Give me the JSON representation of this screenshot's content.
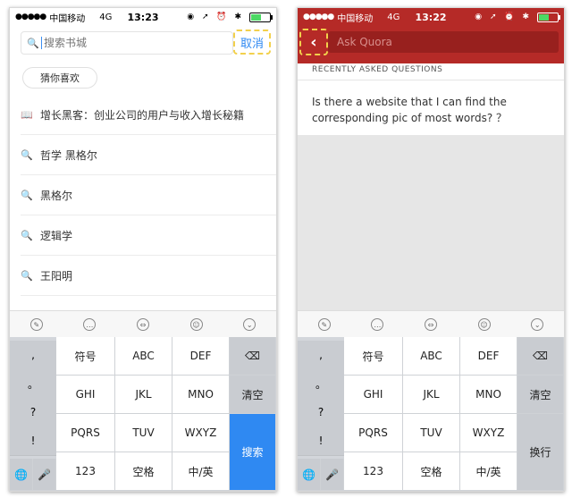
{
  "left": {
    "status": {
      "dots": "●●●●●",
      "carrier": "中国移动",
      "network": "4G",
      "time": "13:23",
      "icons": "◉ ➚ ⏰ ✱"
    },
    "search": {
      "placeholder": "搜索书城",
      "cancel": "取消"
    },
    "suggest_chip": "猜你喜欢",
    "items": [
      {
        "label": "增长黑客：创业公司的用户与收入增长秘籍",
        "icon": "book-icon",
        "glyph": "📖"
      },
      {
        "label": "哲学 黑格尔",
        "icon": "search-icon",
        "glyph": "🔍"
      },
      {
        "label": "黑格尔",
        "icon": "search-icon",
        "glyph": "🔍"
      },
      {
        "label": "逻辑学",
        "icon": "search-icon",
        "glyph": "🔍"
      },
      {
        "label": "王阳明",
        "icon": "search-icon",
        "glyph": "🔍"
      }
    ],
    "keyboard": {
      "side_keys": [
        ",",
        "。",
        "?",
        "!"
      ],
      "row1": [
        "符号",
        "ABC",
        "DEF"
      ],
      "row2": [
        "GHI",
        "JKL",
        "MNO"
      ],
      "row3": [
        "PQRS",
        "TUV",
        "WXYZ"
      ],
      "row4": [
        "123",
        "空格",
        "中/英"
      ],
      "delete": "⌫",
      "clear": "清空",
      "action": "搜索",
      "globe": "🌐",
      "mic": "🎤"
    }
  },
  "right": {
    "status": {
      "dots": "●●●●●",
      "carrier": "中国移动",
      "network": "4G",
      "time": "13:22",
      "icons": "◉ ➚ ⏰ ✱"
    },
    "search": {
      "placeholder": "Ask Quora",
      "back": "‹"
    },
    "recent_title": "RECENTLY ASKED QUESTIONS",
    "question": "Is there a website that I can find the corresponding pic of most words? ？",
    "keyboard": {
      "side_keys": [
        ",",
        "。",
        "?",
        "!"
      ],
      "row1": [
        "符号",
        "ABC",
        "DEF"
      ],
      "row2": [
        "GHI",
        "JKL",
        "MNO"
      ],
      "row3": [
        "PQRS",
        "TUV",
        "WXYZ"
      ],
      "row4": [
        "123",
        "空格",
        "中/英"
      ],
      "delete": "⌫",
      "clear": "清空",
      "action": "换行",
      "globe": "🌐",
      "mic": "🎤"
    }
  },
  "colors": {
    "quora_red": "#b52a27",
    "ios_blue": "#2f89f2",
    "highlight": "#f2d04c"
  }
}
